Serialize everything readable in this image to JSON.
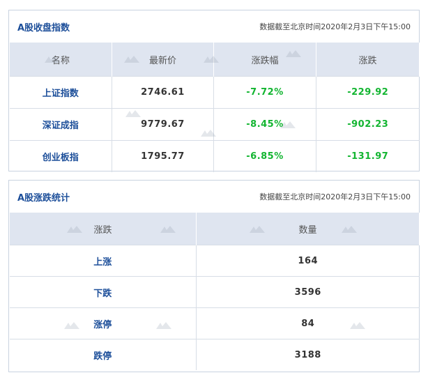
{
  "index_panel": {
    "title": "A股收盘指数",
    "date_note": "数据截至北京时间2020年2月3日下午15:00",
    "columns": [
      "名称",
      "最新价",
      "涨跌幅",
      "涨跌"
    ],
    "rows": [
      {
        "name": "上证指数",
        "price": "2746.61",
        "pct": "-7.72%",
        "change": "-229.92"
      },
      {
        "name": "深证成指",
        "price": "9779.67",
        "pct": "-8.45%",
        "change": "-902.23"
      },
      {
        "name": "创业板指",
        "price": "1795.77",
        "pct": "-6.85%",
        "change": "-131.97"
      }
    ]
  },
  "stats_panel": {
    "title": "A股涨跌统计",
    "date_note": "数据截至北京时间2020年2月3日下午15:00",
    "columns": [
      "涨跌",
      "数量"
    ],
    "rows": [
      {
        "label": "上涨",
        "count": "164"
      },
      {
        "label": "下跌",
        "count": "3596"
      },
      {
        "label": "涨停",
        "count": "84"
      },
      {
        "label": "跌停",
        "count": "3188"
      }
    ]
  },
  "colors": {
    "title_blue": "#1d4f9a",
    "header_bg": "#dfe5f0",
    "down_green": "#13b531",
    "border": "#c9d3e0"
  },
  "watermark_icon": "nbd-logo-watermark"
}
